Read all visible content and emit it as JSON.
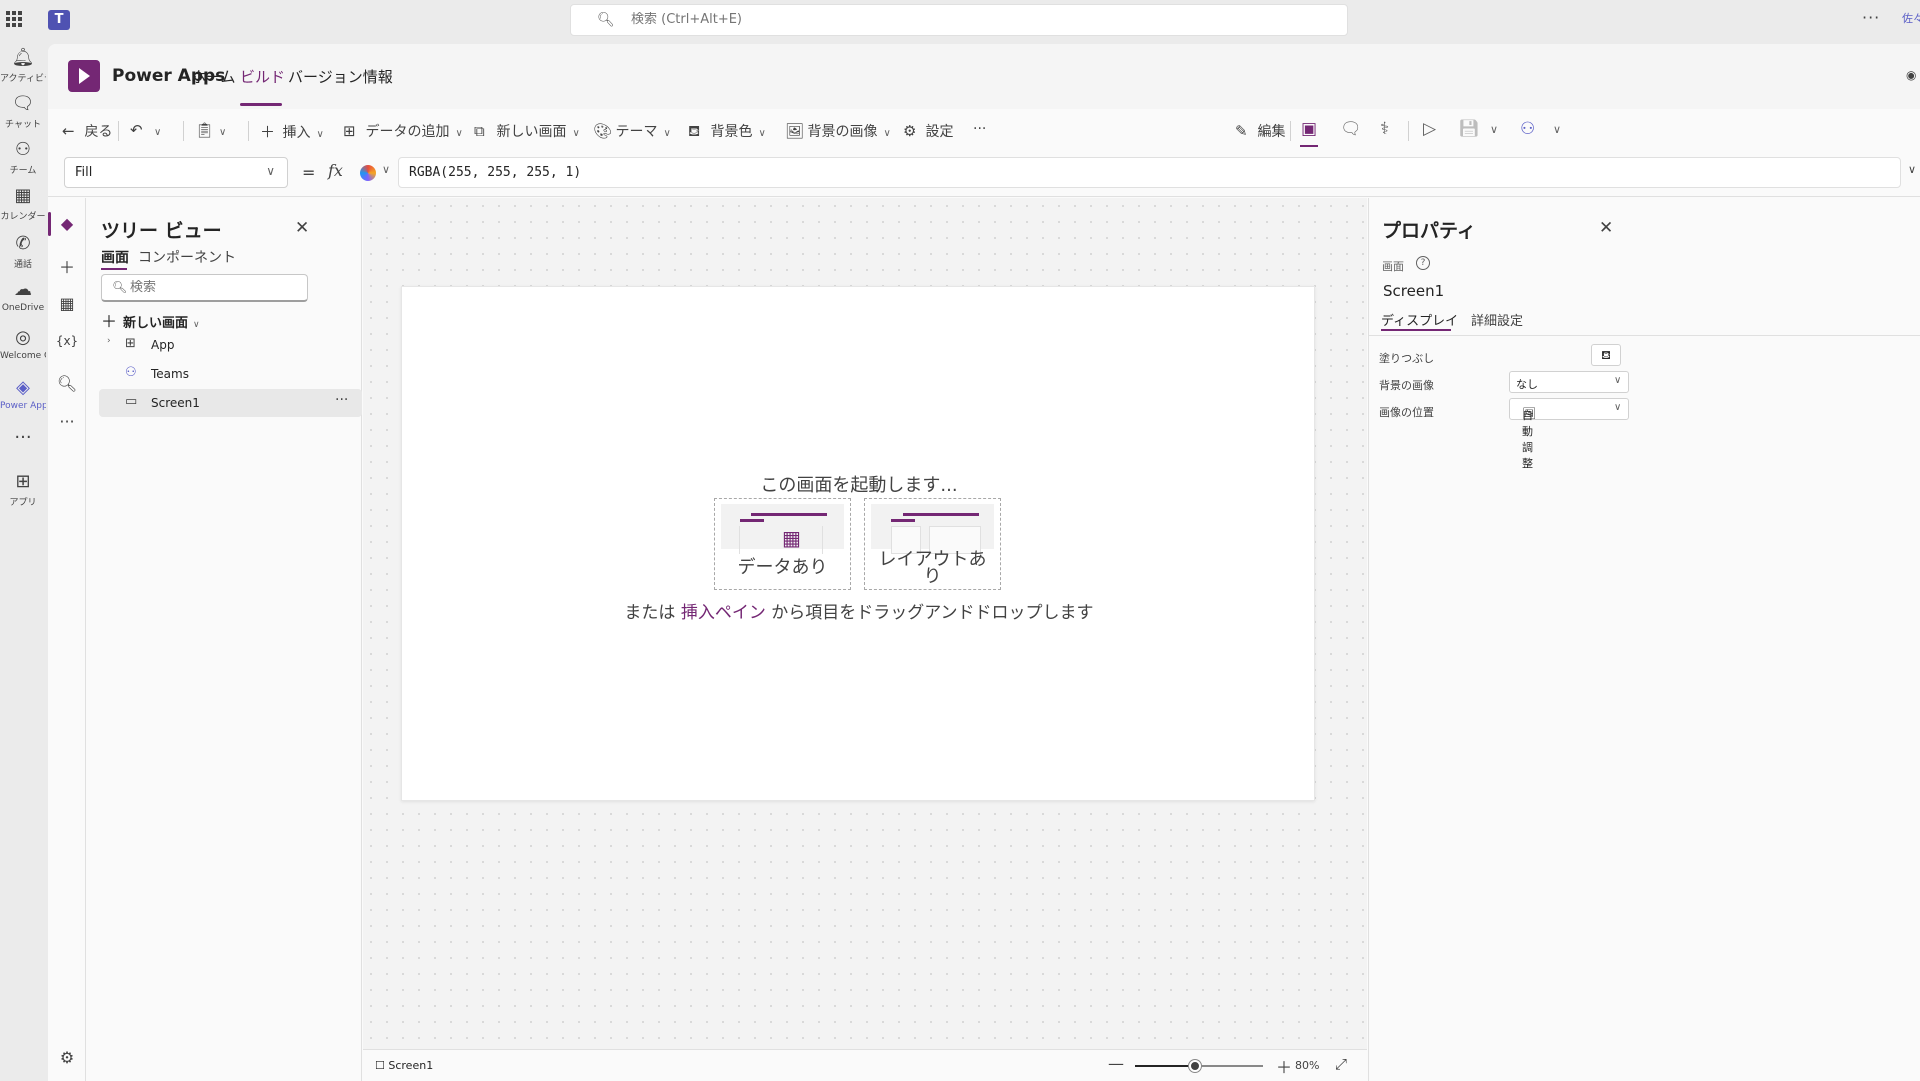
{
  "topbar": {
    "search_placeholder": "検索 (Ctrl+Alt+E)",
    "more": "···",
    "avatar": "佐々"
  },
  "teams_rail": [
    {
      "label": "アクティビティ",
      "icon": "bell-icon",
      "glyph": "🔔"
    },
    {
      "label": "チャット",
      "icon": "chat-icon",
      "glyph": "💬"
    },
    {
      "label": "チーム",
      "icon": "teams-icon",
      "glyph": "👥"
    },
    {
      "label": "カレンダー",
      "icon": "calendar-icon",
      "glyph": "📅"
    },
    {
      "label": "通話",
      "icon": "phone-icon",
      "glyph": "📞"
    },
    {
      "label": "OneDrive",
      "icon": "cloud-icon",
      "glyph": "☁"
    },
    {
      "label": "Welcome G...",
      "icon": "welcome-icon",
      "glyph": "◎"
    },
    {
      "label": "Power Apps",
      "icon": "power-apps-icon",
      "glyph": "◈"
    },
    {
      "label": "",
      "icon": "more-icon",
      "glyph": "···"
    },
    {
      "label": "アプリ",
      "icon": "add-app-icon",
      "glyph": "⊞"
    }
  ],
  "app_header": {
    "title": "Power Apps",
    "tabs": [
      "ホーム",
      "ビルド",
      "バージョン情報"
    ],
    "active_tab": "ビルド"
  },
  "commands": {
    "back": "戻る",
    "insert": "挿入",
    "add_data": "データの追加",
    "new_screen": "新しい画面",
    "theme": "テーマ",
    "background_color": "背景色",
    "background_image": "背景の画像",
    "settings": "設定",
    "more": "···",
    "edit": "編集"
  },
  "formula_bar": {
    "property": "Fill",
    "equals": "=",
    "fx": "fx",
    "formula": "RGBA(255, 255, 255, 1)"
  },
  "tree_view": {
    "title": "ツリー ビュー",
    "tabs": [
      "画面",
      "コンポーネント"
    ],
    "search_placeholder": "検索",
    "new_screen": "新しい画面",
    "items": [
      {
        "label": "App",
        "icon": "app-icon"
      },
      {
        "label": "Teams",
        "icon": "teams-icon"
      },
      {
        "label": "Screen1",
        "icon": "screen-icon"
      }
    ],
    "selected": "Screen1"
  },
  "canvas": {
    "start_text": "この画面を起動します...",
    "card_data": "データあり",
    "card_layout": "レイアウトあり",
    "drag_prefix": "または",
    "drag_link": "挿入ペイン",
    "drag_suffix": "から項目をドラッグアンドドロップします"
  },
  "statusbar": {
    "screen": "Screen1",
    "zoom": "80%",
    "zoom_value": 0.8
  },
  "properties": {
    "title": "プロパティ",
    "kind": "画面",
    "name": "Screen1",
    "tabs": [
      "ディスプレイ",
      "詳細設定"
    ],
    "rows": [
      {
        "label": "塗りつぶし",
        "value": ""
      },
      {
        "label": "背景の画像",
        "value": "なし"
      },
      {
        "label": "画像の位置",
        "value": "自動調整"
      }
    ]
  },
  "colors": {
    "accent": "#742774",
    "teams_accent": "#5b5fc7"
  }
}
